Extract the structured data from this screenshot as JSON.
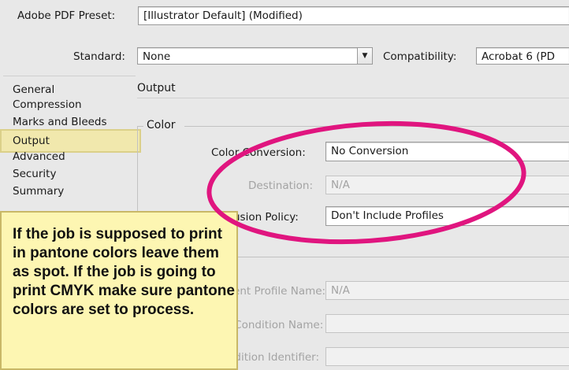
{
  "preset": {
    "label": "Adobe PDF Preset:",
    "value": "[Illustrator Default] (Modified)"
  },
  "standard": {
    "label": "Standard:",
    "value": "None",
    "dropdown_icon": "triangle-down-icon"
  },
  "compatibility": {
    "label": "Compatibility:",
    "value": "Acrobat 6 (PD"
  },
  "sidebar": {
    "items": [
      {
        "label": "General"
      },
      {
        "label": "Compression"
      },
      {
        "label": "Marks and Bleeds"
      },
      {
        "label": "Output",
        "selected": true
      },
      {
        "label": "Advanced"
      },
      {
        "label": "Security"
      },
      {
        "label": "Summary"
      }
    ]
  },
  "main": {
    "section_title": "Output",
    "color_group": {
      "title": "Color",
      "color_conversion": {
        "label": "Color Conversion:",
        "value": "No Conversion"
      },
      "destination": {
        "label": "Destination:",
        "value": "N/A"
      },
      "profile_policy": {
        "label": "Profile Inclusion Policy:",
        "value": "Don't Include Profiles"
      }
    },
    "pdfx_group": {
      "profile_name": {
        "label": "Output Intent Profile Name:",
        "value": "N/A"
      },
      "condition_name": {
        "label": "Output Condition Name:",
        "value": ""
      },
      "condition_identifier": {
        "label": "Output Condition Identifier:",
        "value": ""
      }
    }
  },
  "annotation": {
    "note": "If the job is supposed to print in pantone colors leave them as spot. If the job is going to print CMYK make sure pantone colors are set to process.",
    "ellipse_color": "#e0157f",
    "note_background": "#fdf6b2"
  }
}
